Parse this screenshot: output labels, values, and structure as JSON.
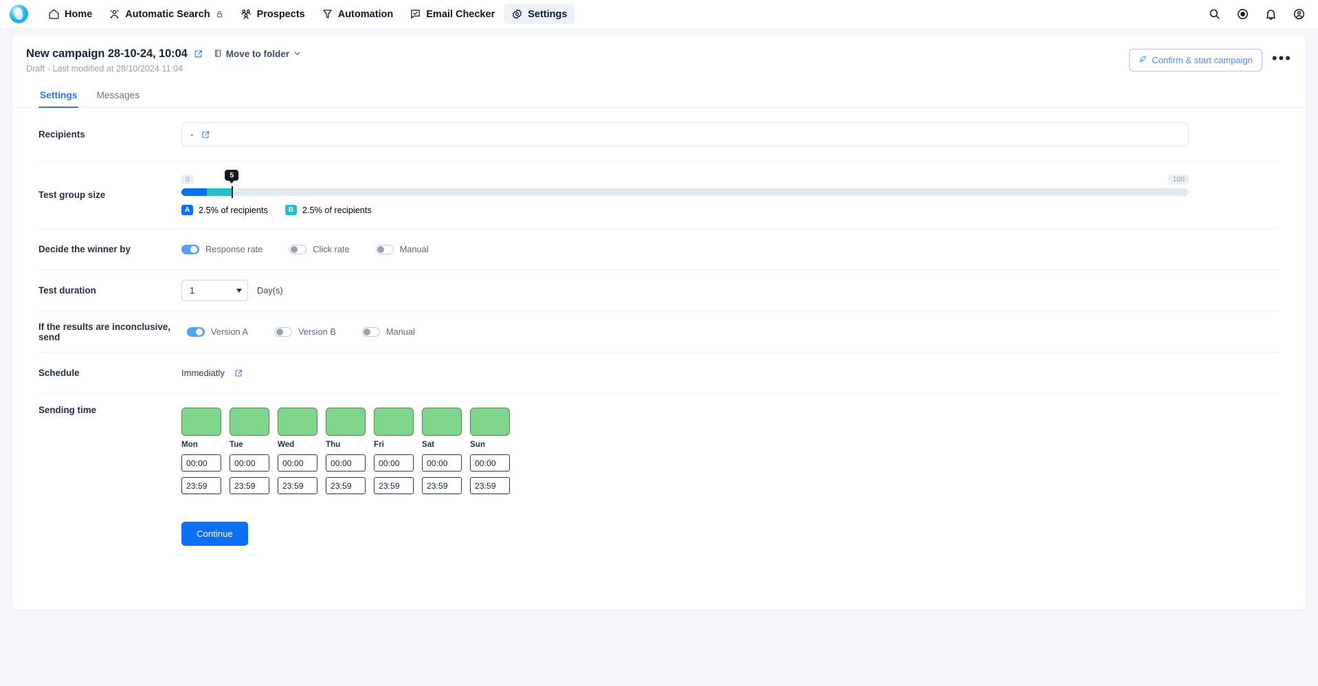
{
  "nav": {
    "logo_name": "app-logo",
    "items": [
      {
        "label": "Home",
        "icon": "home-icon",
        "active": false,
        "locked": false
      },
      {
        "label": "Automatic Search",
        "icon": "person-search-icon",
        "active": false,
        "locked": true
      },
      {
        "label": "Prospects",
        "icon": "people-icon",
        "active": false,
        "locked": false
      },
      {
        "label": "Automation",
        "icon": "funnel-icon",
        "active": false,
        "locked": false
      },
      {
        "label": "Email Checker",
        "icon": "check-shield-icon",
        "active": false,
        "locked": false
      },
      {
        "label": "Settings",
        "icon": "gear-icon",
        "active": true,
        "locked": false
      }
    ],
    "right_icons": [
      "search-icon",
      "coin-icon",
      "bell-icon",
      "account-icon"
    ]
  },
  "header": {
    "title": "New campaign 28-10-24, 10:04",
    "edit_icon": "edit-icon",
    "move_to_folder": "Move to folder",
    "subtitle": "Draft - Last modified at 28/10/2024 11:04",
    "confirm_button": "Confirm & start campaign",
    "more_menu": "•••"
  },
  "tabs": [
    {
      "label": "Settings",
      "active": true
    },
    {
      "label": "Messages",
      "active": false
    }
  ],
  "form": {
    "recipients": {
      "label": "Recipients",
      "value": "-",
      "edit_icon": "edit-icon"
    },
    "test_group_size": {
      "label": "Test group size",
      "min": "0",
      "max": "100",
      "handle_value": "5",
      "variants": [
        {
          "chip": "A",
          "text": "2.5% of recipients",
          "color": "#0b6ff3"
        },
        {
          "chip": "B",
          "text": "2.5% of recipients",
          "color": "#27c0c9"
        }
      ]
    },
    "decide_winner": {
      "label": "Decide the winner by",
      "options": [
        {
          "label": "Response rate",
          "on": true
        },
        {
          "label": "Click rate",
          "on": false
        },
        {
          "label": "Manual",
          "on": false
        }
      ]
    },
    "test_duration": {
      "label": "Test duration",
      "value": "1",
      "unit": "Day(s)"
    },
    "inconclusive": {
      "label": "If the results are inconclusive, send",
      "options": [
        {
          "label": "Version A",
          "on": true
        },
        {
          "label": "Version B",
          "on": false
        },
        {
          "label": "Manual",
          "on": false
        }
      ]
    },
    "schedule": {
      "label": "Schedule",
      "value": "Immediatly",
      "edit_icon": "edit-icon"
    },
    "sending_time": {
      "label": "Sending time",
      "days": [
        {
          "name": "Mon",
          "enabled": true,
          "start": "00:00",
          "end": "23:59"
        },
        {
          "name": "Tue",
          "enabled": true,
          "start": "00:00",
          "end": "23:59"
        },
        {
          "name": "Wed",
          "enabled": true,
          "start": "00:00",
          "end": "23:59"
        },
        {
          "name": "Thu",
          "enabled": true,
          "start": "00:00",
          "end": "23:59"
        },
        {
          "name": "Fri",
          "enabled": true,
          "start": "00:00",
          "end": "23:59"
        },
        {
          "name": "Sat",
          "enabled": true,
          "start": "00:00",
          "end": "23:59"
        },
        {
          "name": "Sun",
          "enabled": true,
          "start": "00:00",
          "end": "23:59"
        }
      ]
    },
    "continue_button": "Continue"
  },
  "colors": {
    "accent_blue": "#0b6ff3",
    "teal": "#27c0c9",
    "day_green": "#81d48b",
    "day_green_border": "#4b8d56"
  }
}
